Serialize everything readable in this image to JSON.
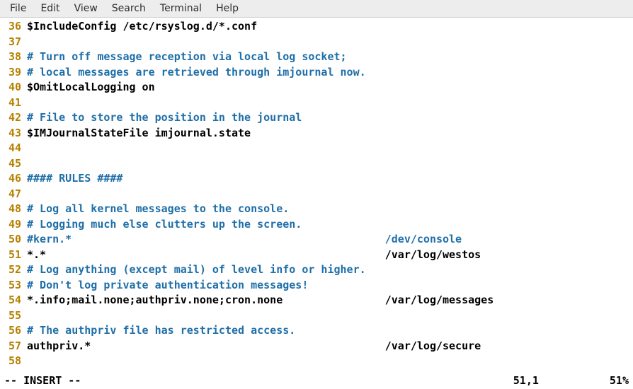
{
  "menu": {
    "items": [
      "File",
      "Edit",
      "View",
      "Search",
      "Terminal",
      "Help"
    ]
  },
  "editor": {
    "lines": [
      {
        "num": "36",
        "tokens": [
          {
            "c": "black",
            "t": "$IncludeConfig /etc/rsyslog.d/*.conf"
          }
        ]
      },
      {
        "num": "37",
        "tokens": []
      },
      {
        "num": "38",
        "tokens": [
          {
            "c": "comment",
            "t": "# Turn off message reception via local log socket;"
          }
        ]
      },
      {
        "num": "39",
        "tokens": [
          {
            "c": "comment",
            "t": "# local messages are retrieved through imjournal now."
          }
        ]
      },
      {
        "num": "40",
        "tokens": [
          {
            "c": "black",
            "t": "$OmitLocalLogging on"
          }
        ]
      },
      {
        "num": "41",
        "tokens": []
      },
      {
        "num": "42",
        "tokens": [
          {
            "c": "comment",
            "t": "# File to store the position in the journal"
          }
        ]
      },
      {
        "num": "43",
        "tokens": [
          {
            "c": "black",
            "t": "$IMJournalStateFile imjournal.state"
          }
        ]
      },
      {
        "num": "44",
        "tokens": []
      },
      {
        "num": "45",
        "tokens": []
      },
      {
        "num": "46",
        "tokens": [
          {
            "c": "comment",
            "t": "#### RULES ####"
          }
        ]
      },
      {
        "num": "47",
        "tokens": []
      },
      {
        "num": "48",
        "tokens": [
          {
            "c": "comment",
            "t": "# Log all kernel messages to the console."
          }
        ]
      },
      {
        "num": "49",
        "tokens": [
          {
            "c": "comment",
            "t": "# Logging much else clutters up the screen."
          }
        ]
      },
      {
        "num": "50",
        "tokens": [
          {
            "c": "comment",
            "t": "#kern.*                                                 /dev/console"
          }
        ]
      },
      {
        "num": "51",
        "tokens": [
          {
            "c": "black",
            "t": "*.*                                                     /var/log/westos"
          }
        ]
      },
      {
        "num": "52",
        "tokens": [
          {
            "c": "comment",
            "t": "# Log anything (except mail) of level info or higher."
          }
        ]
      },
      {
        "num": "53",
        "tokens": [
          {
            "c": "comment",
            "t": "# Don't log private authentication messages!"
          }
        ]
      },
      {
        "num": "54",
        "tokens": [
          {
            "c": "black",
            "t": "*.info;mail.none;authpriv.none;cron.none                /var/log/messages"
          }
        ]
      },
      {
        "num": "55",
        "tokens": []
      },
      {
        "num": "56",
        "tokens": [
          {
            "c": "comment",
            "t": "# The authpriv file has restricted access."
          }
        ]
      },
      {
        "num": "57",
        "tokens": [
          {
            "c": "black",
            "t": "authpriv.*                                              /var/log/secure"
          }
        ]
      },
      {
        "num": "58",
        "tokens": []
      }
    ]
  },
  "status": {
    "mode": "-- INSERT --",
    "position": "51,1",
    "percent": "51%"
  }
}
